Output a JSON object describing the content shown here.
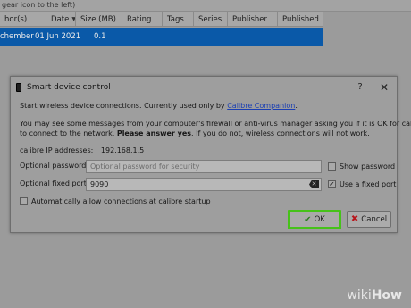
{
  "background": {
    "hint": "gear icon to the left)",
    "columns": [
      {
        "label": "hor(s)",
        "sort": false
      },
      {
        "label": "Date",
        "sort": true
      },
      {
        "label": "Size (MB)",
        "sort": false
      },
      {
        "label": "Rating",
        "sort": false
      },
      {
        "label": "Tags",
        "sort": false
      },
      {
        "label": "Series",
        "sort": false
      },
      {
        "label": "Publisher",
        "sort": false
      },
      {
        "label": "Published",
        "sort": false
      }
    ],
    "selected_row": {
      "author": "chember",
      "date": "01 Jun 2021",
      "size": "0.1"
    },
    "selection_color": "#0a59a8"
  },
  "dialog": {
    "title": "Smart device control",
    "help_glyph": "?",
    "close_glyph": "✕",
    "intro_prefix": "Start wireless device connections. Currently used only by ",
    "intro_link": "Calibre Companion",
    "intro_suffix": ".",
    "firewall_line1": "You may see some messages from your computer's firewall or anti-virus manager asking you if it is OK for calibre",
    "firewall_line2_prefix": "to connect to the network. ",
    "firewall_line2_bold": "Please answer yes",
    "firewall_line2_suffix": ". If you do not, wireless connections will not work.",
    "ip_label": "calibre IP addresses:",
    "ip_value": "192.168.1.5",
    "password": {
      "label": "Optional password:",
      "placeholder": "Optional password for security",
      "value": ""
    },
    "show_password": {
      "label": "Show password",
      "checked": false
    },
    "port": {
      "label": "Optional fixed port:",
      "value": "9090"
    },
    "use_fixed_port": {
      "label": "Use a fixed port",
      "checked": true
    },
    "auto_connect": {
      "label": "Automatically allow connections at calibre startup",
      "checked": false
    },
    "ok_label": "OK",
    "cancel_label": "Cancel",
    "highlight_color": "#46c219"
  },
  "watermark": {
    "prefix": "wiki",
    "suffix": "How"
  }
}
